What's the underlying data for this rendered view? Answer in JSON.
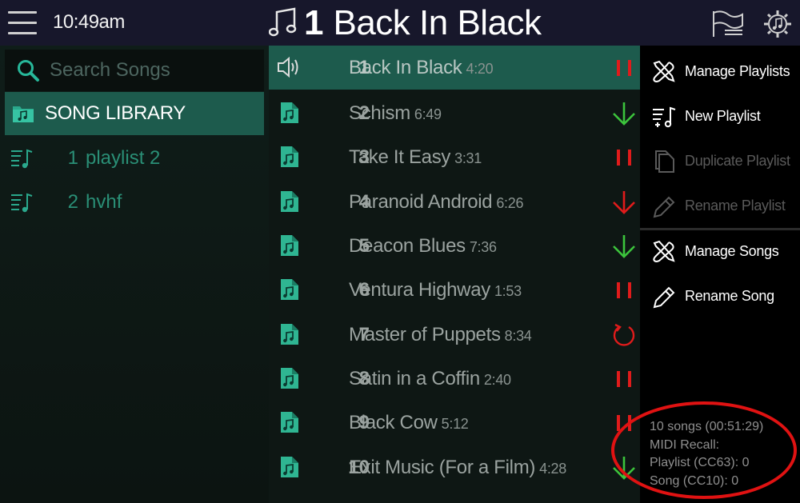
{
  "header": {
    "time": "10:49am",
    "current_song_number": "1",
    "current_song_title": "Back In Black"
  },
  "search": {
    "placeholder": "Search Songs"
  },
  "library": {
    "label": "SONG LIBRARY"
  },
  "playlists": [
    {
      "number": "1",
      "name": "playlist 2"
    },
    {
      "number": "2",
      "name": "hvhf"
    }
  ],
  "songs": [
    {
      "number": "1",
      "name": "Back In Black",
      "duration": "4:20",
      "status": "pause",
      "playing": true
    },
    {
      "number": "2",
      "name": "Schism",
      "duration": "6:49",
      "status": "down-green"
    },
    {
      "number": "3",
      "name": "Take It Easy",
      "duration": "3:31",
      "status": "pause"
    },
    {
      "number": "4",
      "name": "Paranoid Android",
      "duration": "6:26",
      "status": "down-red"
    },
    {
      "number": "5",
      "name": "Deacon Blues",
      "duration": "7:36",
      "status": "down-green"
    },
    {
      "number": "6",
      "name": "Ventura Highway",
      "duration": "1:53",
      "status": "pause"
    },
    {
      "number": "7",
      "name": "Master of Puppets",
      "duration": "8:34",
      "status": "loop"
    },
    {
      "number": "8",
      "name": "Satin in a Coffin",
      "duration": "2:40",
      "status": "pause"
    },
    {
      "number": "9",
      "name": "Black Cow",
      "duration": "5:12",
      "status": "pause"
    },
    {
      "number": "10",
      "name": "Exit Music (For a Film)",
      "duration": "4:28",
      "status": "down-green"
    }
  ],
  "menu": {
    "manage_playlists": "Manage Playlists",
    "new_playlist": "New Playlist",
    "duplicate_playlist": "Duplicate Playlist",
    "rename_playlist": "Rename Playlist",
    "manage_songs": "Manage Songs",
    "rename_song": "Rename Song"
  },
  "info": {
    "songs_summary": "10 songs (00:51:29)",
    "midi_recall": "MIDI Recall:",
    "playlist_cc": "Playlist (CC63): 0",
    "song_cc": "Song (CC10): 0"
  },
  "colors": {
    "accent": "#1d5b4d",
    "status_red": "#e01b1b",
    "status_green": "#3cc43c",
    "teal_text": "#2a8f76"
  },
  "icons": {
    "menu": "hamburger-icon",
    "title": "music-note-icon",
    "playlists": "playlist-music-icon",
    "settings": "settings-gear-music-icon",
    "search": "search-icon",
    "library": "music-folder-icon",
    "playing": "speaker-icon",
    "song": "music-file-icon",
    "manage": "tools-icon",
    "new_playlist": "add-playlist-icon",
    "duplicate": "duplicate-icon",
    "rename": "pencil-icon"
  }
}
